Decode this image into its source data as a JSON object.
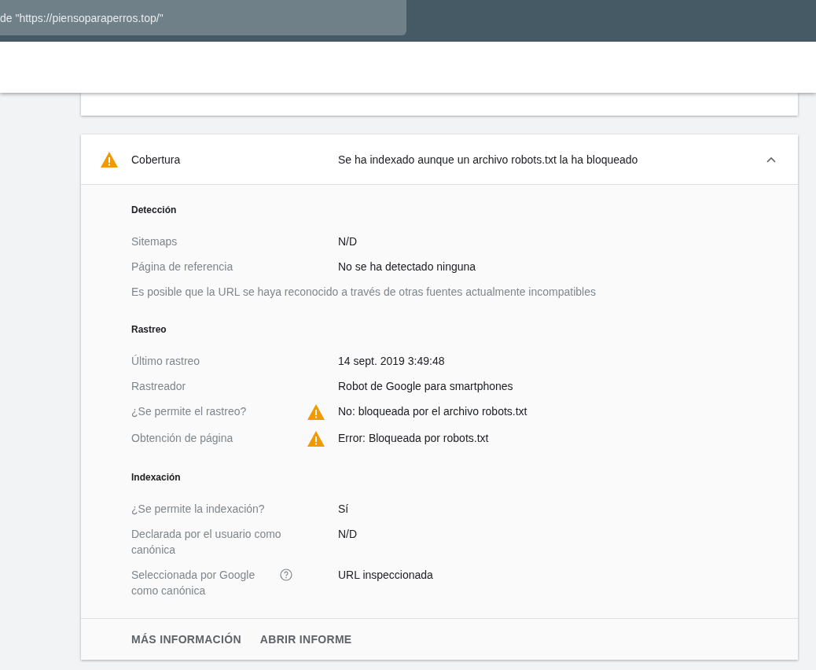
{
  "top_bar": {
    "search": {
      "value": "de \"https://piensoparaperros.top/\""
    }
  },
  "coverage": {
    "warning": true,
    "title": "Cobertura",
    "summary": "Se ha indexado aunque un archivo robots.txt la ha bloqueado",
    "expanded": true,
    "sections": [
      {
        "title": "Detección",
        "rows": [
          {
            "kind": "field",
            "label": "Sitemaps",
            "value": "N/D",
            "warning": false,
            "help": false
          },
          {
            "kind": "field",
            "label": "Página de referencia",
            "value": "No se ha detectado ninguna",
            "warning": false,
            "help": false
          },
          {
            "kind": "note",
            "text": "Es posible que la URL se haya reconocido a través de otras fuentes actualmente incompatibles"
          }
        ]
      },
      {
        "title": "Rastreo",
        "rows": [
          {
            "kind": "field",
            "label": "Último rastreo",
            "value": "14 sept. 2019 3:49:48",
            "warning": false,
            "help": false
          },
          {
            "kind": "field",
            "label": "Rastreador",
            "value": "Robot de Google para smartphones",
            "warning": false,
            "help": false
          },
          {
            "kind": "field",
            "label": "¿Se permite el rastreo?",
            "value": "No: bloqueada por el archivo robots.txt",
            "warning": true,
            "help": false
          },
          {
            "kind": "field",
            "label": "Obtención de página",
            "value": "Error: Bloqueada por robots.txt",
            "warning": true,
            "help": false
          }
        ]
      },
      {
        "title": "Indexación",
        "rows": [
          {
            "kind": "field",
            "label": "¿Se permite la indexación?",
            "value": "Sí",
            "warning": false,
            "help": false
          },
          {
            "kind": "field",
            "label": "Declarada por el usuario como canónica",
            "value": "N/D",
            "warning": false,
            "help": false
          },
          {
            "kind": "field",
            "label": "Seleccionada por Google como canónica",
            "value": "URL inspeccionada",
            "warning": false,
            "help": true
          }
        ]
      }
    ],
    "buttons": [
      "MÁS INFORMACIÓN",
      "ABRIR INFORME"
    ]
  }
}
